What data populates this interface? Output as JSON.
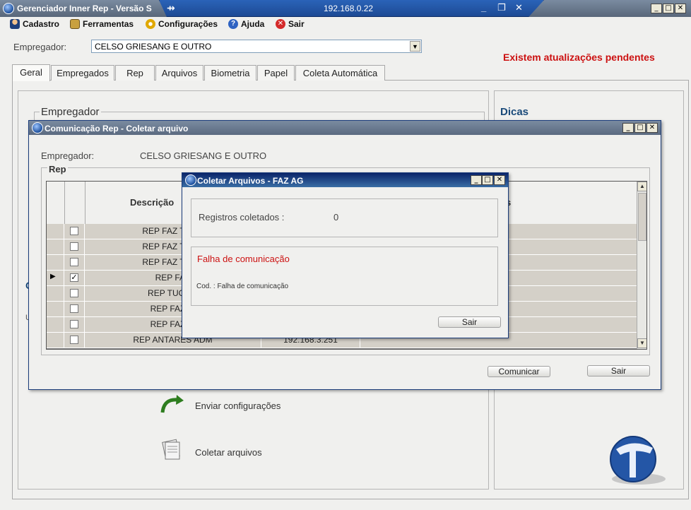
{
  "window": {
    "title": "Gerenciador Inner Rep - Versão S",
    "min": "_",
    "max": "□",
    "close": "✕"
  },
  "rdp": {
    "ip": "192.168.0.22",
    "pin": "⇸",
    "min": "_",
    "restore": "❐",
    "close": "✕"
  },
  "menu": [
    {
      "label": "Cadastro",
      "icon": "person-icon"
    },
    {
      "label": "Ferramentas",
      "icon": "tools-icon"
    },
    {
      "label": "Configurações",
      "icon": "gear-icon"
    },
    {
      "label": "Ajuda",
      "icon": "help-icon"
    },
    {
      "label": "Sair",
      "icon": "exit-icon"
    }
  ],
  "employer": {
    "label": "Empregador:",
    "value": "CELSO GRIESANG E OUTRO",
    "arrow": "▼"
  },
  "updates_notice": "Existem atualizações pendentes",
  "tabs": [
    "Geral",
    "Empregados",
    "Rep",
    "Arquivos",
    "Biometria",
    "Papel",
    "Coleta Automática"
  ],
  "panel": {
    "group_title": "Empregador",
    "tips_title": "Dicas",
    "actions": [
      {
        "label": "Enviar configurações",
        "icon": "send-config-icon"
      },
      {
        "label": "Coletar arquivos",
        "icon": "collect-files-icon"
      }
    ],
    "partial_left_1": "C",
    "partial_left_2": "U"
  },
  "comm_dialog": {
    "title": "Comunicação Rep - Coletar arquivo",
    "employer_label": "Empregador:",
    "employer_value": "CELSO GRIESANG E OUTRO",
    "group_title": "Rep",
    "column_descricao": "Descrição",
    "column_partial": "s",
    "rows": [
      {
        "desc": "REP FAZ TROP",
        "checked": false,
        "ip": "",
        "current": false
      },
      {
        "desc": "REP FAZ TROP",
        "checked": false,
        "ip": "",
        "current": false
      },
      {
        "desc": "REP FAZ TROP",
        "checked": false,
        "ip": "",
        "current": false
      },
      {
        "desc": "REP FAZ",
        "checked": true,
        "ip": "",
        "current": true
      },
      {
        "desc": "REP TUGOR",
        "checked": false,
        "ip": "",
        "current": false
      },
      {
        "desc": "REP FAZ AI",
        "checked": false,
        "ip": "",
        "current": false
      },
      {
        "desc": "REP FAZ AI",
        "checked": false,
        "ip": "",
        "current": false
      },
      {
        "desc": "REP ANTARES ADM",
        "checked": false,
        "ip": "192.168.3.251",
        "current": false
      }
    ],
    "check_mark": "✓",
    "row_pointer": "▶",
    "scroll_up": "▲",
    "scroll_down": "▼",
    "comunicar_label": "Comunicar",
    "sair_label": "Sair"
  },
  "collect_dialog": {
    "title": "Coletar Arquivos - FAZ AG",
    "records_label": "Registros coletados :",
    "records_value": "0",
    "error_title": "Falha de comunicação",
    "error_detail": "Cod. : Falha de comunicação",
    "sair_label": "Sair"
  },
  "colors": {
    "accent_red": "#cc1111",
    "tips_blue": "#1a4a7a",
    "titlebar_active": "#0a246a"
  }
}
